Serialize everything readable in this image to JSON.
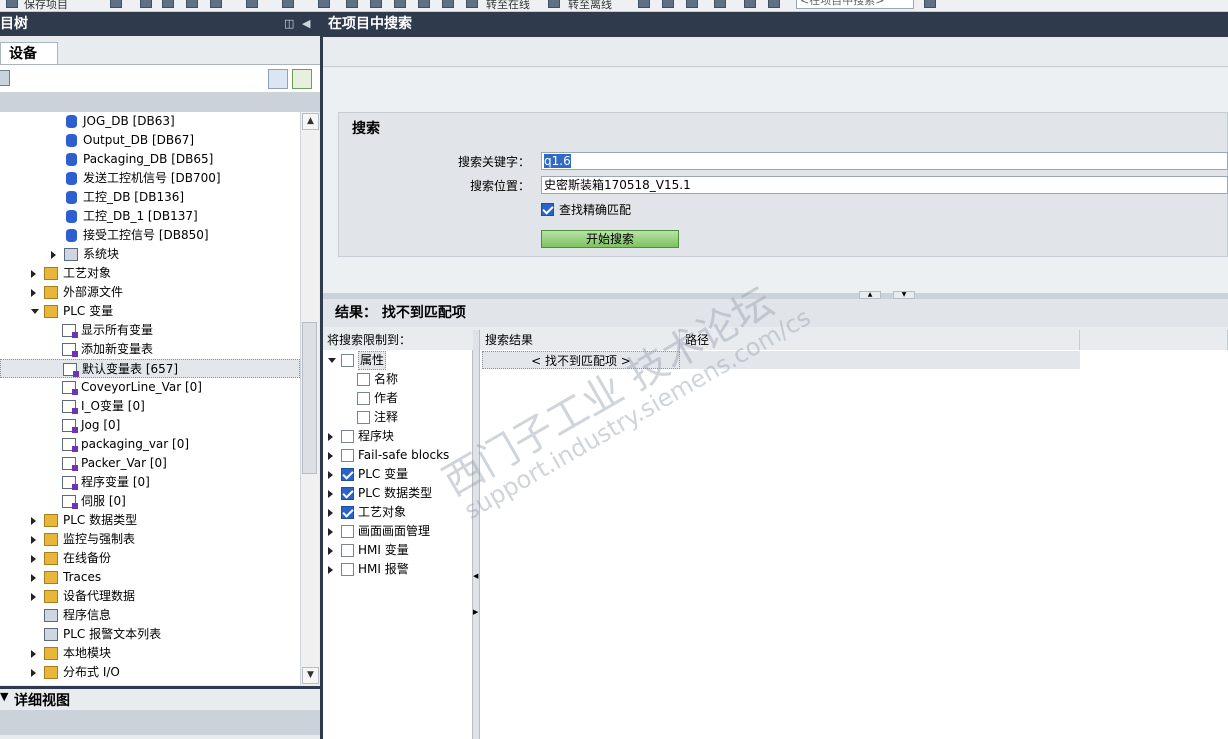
{
  "toolbar": {
    "save_label": "保存项目",
    "online_label": "转至在线",
    "offline_label": "转至离线",
    "search_placeholder": "<在项目中搜索>"
  },
  "left_pane": {
    "title": "项目树",
    "tab": "设备",
    "details_title": "详细视图",
    "tree": [
      {
        "label": "JOG_DB [DB63]",
        "level": 4,
        "icon": "db-icon"
      },
      {
        "label": "Output_DB [DB67]",
        "level": 4,
        "icon": "db-icon"
      },
      {
        "label": "Packaging_DB [DB65]",
        "level": 4,
        "icon": "db-icon"
      },
      {
        "label": "发送工控机信号 [DB700]",
        "level": 4,
        "icon": "db-icon"
      },
      {
        "label": "工控_DB [DB136]",
        "level": 4,
        "icon": "db-icon"
      },
      {
        "label": "工控_DB_1 [DB137]",
        "level": 4,
        "icon": "db-icon"
      },
      {
        "label": "接受工控信号 [DB850]",
        "level": 4,
        "icon": "db-icon"
      },
      {
        "label": "系统块",
        "level": 3,
        "icon": "system-block-icon",
        "expand": "closed"
      },
      {
        "label": "工艺对象",
        "level": 2,
        "icon": "folder-icon",
        "expand": "closed"
      },
      {
        "label": "外部源文件",
        "level": 2,
        "icon": "folder-icon",
        "expand": "closed"
      },
      {
        "label": "PLC 变量",
        "level": 2,
        "icon": "folder-icon",
        "expand": "open"
      },
      {
        "label": "显示所有变量",
        "level": 3,
        "icon": "tag-table-icon"
      },
      {
        "label": "添加新变量表",
        "level": 3,
        "icon": "add-table-icon"
      },
      {
        "label": "默认变量表 [657]",
        "level": 3,
        "icon": "tag-table-icon",
        "selected": true
      },
      {
        "label": "CoveyorLine_Var [0]",
        "level": 3,
        "icon": "tag-table-icon"
      },
      {
        "label": "I_O变量 [0]",
        "level": 3,
        "icon": "tag-table-icon"
      },
      {
        "label": "Jog [0]",
        "level": 3,
        "icon": "tag-table-icon"
      },
      {
        "label": "packaging_var [0]",
        "level": 3,
        "icon": "tag-table-icon"
      },
      {
        "label": "Packer_Var [0]",
        "level": 3,
        "icon": "tag-table-icon"
      },
      {
        "label": "程序变量 [0]",
        "level": 3,
        "icon": "tag-table-icon"
      },
      {
        "label": "伺服 [0]",
        "level": 3,
        "icon": "tag-table-icon"
      },
      {
        "label": "PLC 数据类型",
        "level": 2,
        "icon": "folder-icon",
        "expand": "closed"
      },
      {
        "label": "监控与强制表",
        "level": 2,
        "icon": "folder-icon",
        "expand": "closed"
      },
      {
        "label": "在线备份",
        "level": 2,
        "icon": "folder-icon",
        "expand": "closed"
      },
      {
        "label": "Traces",
        "level": 2,
        "icon": "folder-icon",
        "expand": "closed"
      },
      {
        "label": "设备代理数据",
        "level": 2,
        "icon": "folder-icon",
        "expand": "closed"
      },
      {
        "label": "程序信息",
        "level": 2,
        "icon": "program-info-icon"
      },
      {
        "label": "PLC 报警文本列表",
        "level": 2,
        "icon": "text-list-icon"
      },
      {
        "label": "本地模块",
        "level": 2,
        "icon": "folder-icon",
        "expand": "closed"
      },
      {
        "label": "分布式 I/O",
        "level": 2,
        "icon": "folder-icon",
        "expand": "closed"
      }
    ]
  },
  "search_panel": {
    "title": "在项目中搜索",
    "section_title": "搜索",
    "keyword_label": "搜索关键字：",
    "keyword_value": "q1.6",
    "location_label": "搜索位置：",
    "location_value": "史密斯装箱170518_V15.1",
    "exact_match_label": "查找精确匹配",
    "exact_match_checked": true,
    "start_button": "开始搜索"
  },
  "results": {
    "title": "结果： 找不到匹配项",
    "filter_header": "将搜索限制到：",
    "col_result": "搜索结果",
    "col_path": "路径",
    "no_match_row": "< 找不到匹配项 >",
    "filters": [
      {
        "label": "属性",
        "level": 0,
        "expand": "open",
        "checked": false
      },
      {
        "label": "名称",
        "level": 1,
        "checked": false
      },
      {
        "label": "作者",
        "level": 1,
        "checked": false
      },
      {
        "label": "注释",
        "level": 1,
        "checked": false
      },
      {
        "label": "程序块",
        "level": 0,
        "expand": "closed",
        "checked": false
      },
      {
        "label": "Fail-safe blocks",
        "level": 0,
        "expand": "closed",
        "checked": false
      },
      {
        "label": "PLC 变量",
        "level": 0,
        "expand": "closed",
        "checked": true
      },
      {
        "label": "PLC 数据类型",
        "level": 0,
        "expand": "closed",
        "checked": true
      },
      {
        "label": "工艺对象",
        "level": 0,
        "expand": "closed",
        "checked": true
      },
      {
        "label": "画面画面管理",
        "level": 0,
        "expand": "closed",
        "checked": false
      },
      {
        "label": "HMI 变量",
        "level": 0,
        "expand": "closed",
        "checked": false
      },
      {
        "label": "HMI 报警",
        "level": 0,
        "expand": "closed",
        "checked": false
      }
    ]
  },
  "watermark": {
    "line1": "西门子工业 技术论坛",
    "line2": "support.industry.siemens.com/cs"
  }
}
